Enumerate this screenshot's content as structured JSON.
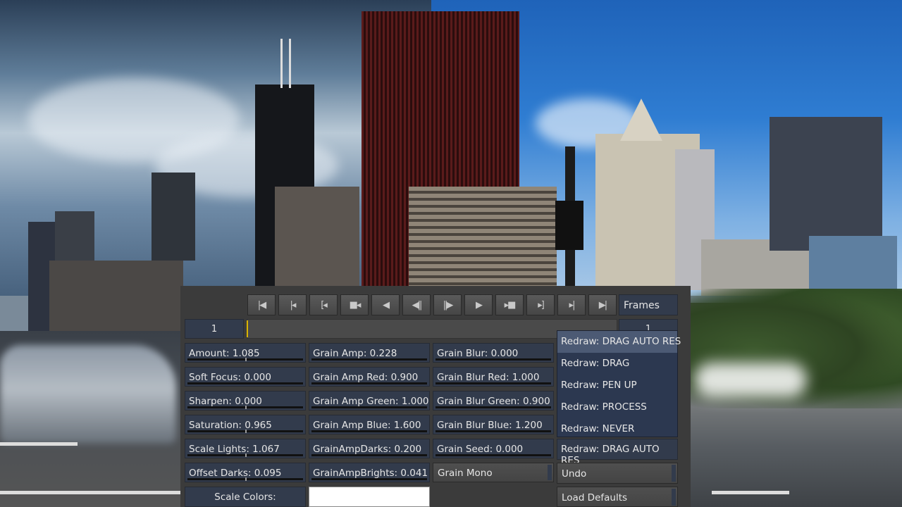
{
  "transport": {
    "buttons": [
      {
        "name": "goto-start",
        "glyph": "|◀"
      },
      {
        "name": "prev-keyframe",
        "glyph": "|◂"
      },
      {
        "name": "prev-mark",
        "glyph": "[◂"
      },
      {
        "name": "step-back-stop",
        "glyph": "■◂"
      },
      {
        "name": "play-backward",
        "glyph": "◀"
      },
      {
        "name": "step-backward",
        "glyph": "◀||"
      },
      {
        "name": "step-forward",
        "glyph": "||▶"
      },
      {
        "name": "play-forward",
        "glyph": "▶"
      },
      {
        "name": "step-forward-stop",
        "glyph": "▸■"
      },
      {
        "name": "next-mark",
        "glyph": "▸]"
      },
      {
        "name": "next-keyframe",
        "glyph": "▸|"
      },
      {
        "name": "goto-end",
        "glyph": "▶|"
      }
    ],
    "frames_label": "Frames",
    "current_frame": "1",
    "end_frame": "1"
  },
  "params": {
    "col1": [
      {
        "label": "Amount: 1.085",
        "marker": 0.5
      },
      {
        "label": "Soft Focus: 0.000",
        "marker": null
      },
      {
        "label": "Sharpen: 0.000",
        "marker": 0.5
      },
      {
        "label": "Saturation: 0.965",
        "marker": 0.5
      },
      {
        "label": "Scale Lights: 1.067",
        "marker": 0.5
      },
      {
        "label": "Offset Darks: 0.095",
        "marker": 0.5
      }
    ],
    "col2": [
      {
        "label": "Grain Amp: 0.228"
      },
      {
        "label": "Grain Amp Red: 0.900"
      },
      {
        "label": "Grain Amp Green: 1.000"
      },
      {
        "label": "Grain Amp Blue: 1.600"
      },
      {
        "label": "GrainAmpDarks: 0.200"
      },
      {
        "label": "GrainAmpBrights: 0.041"
      }
    ],
    "col3": [
      {
        "label": "Grain Blur: 0.000"
      },
      {
        "label": "Grain Blur Red: 1.000"
      },
      {
        "label": "Grain Blur Green: 0.900"
      },
      {
        "label": "Grain Blur Blue: 1.200"
      },
      {
        "label": "Grain Seed: 0.000"
      }
    ]
  },
  "grain_mono_label": "Grain Mono",
  "scale_colors_label": "Scale Colors:",
  "scale_colors_swatch": "#ffffff",
  "redraw": {
    "options": [
      "Redraw: DRAG AUTO RES",
      "Redraw: DRAG",
      "Redraw: PEN UP",
      "Redraw: PROCESS",
      "Redraw: NEVER"
    ],
    "selected_index": 0,
    "current": "Redraw: DRAG AUTO RES"
  },
  "undo_label": "Undo",
  "load_defaults_label": "Load Defaults",
  "colors": {
    "field_bg": "#323b4c",
    "panel_bg": "#3b3b3b",
    "playhead": "#d9b400",
    "menu_highlight": "#4c5a74"
  }
}
